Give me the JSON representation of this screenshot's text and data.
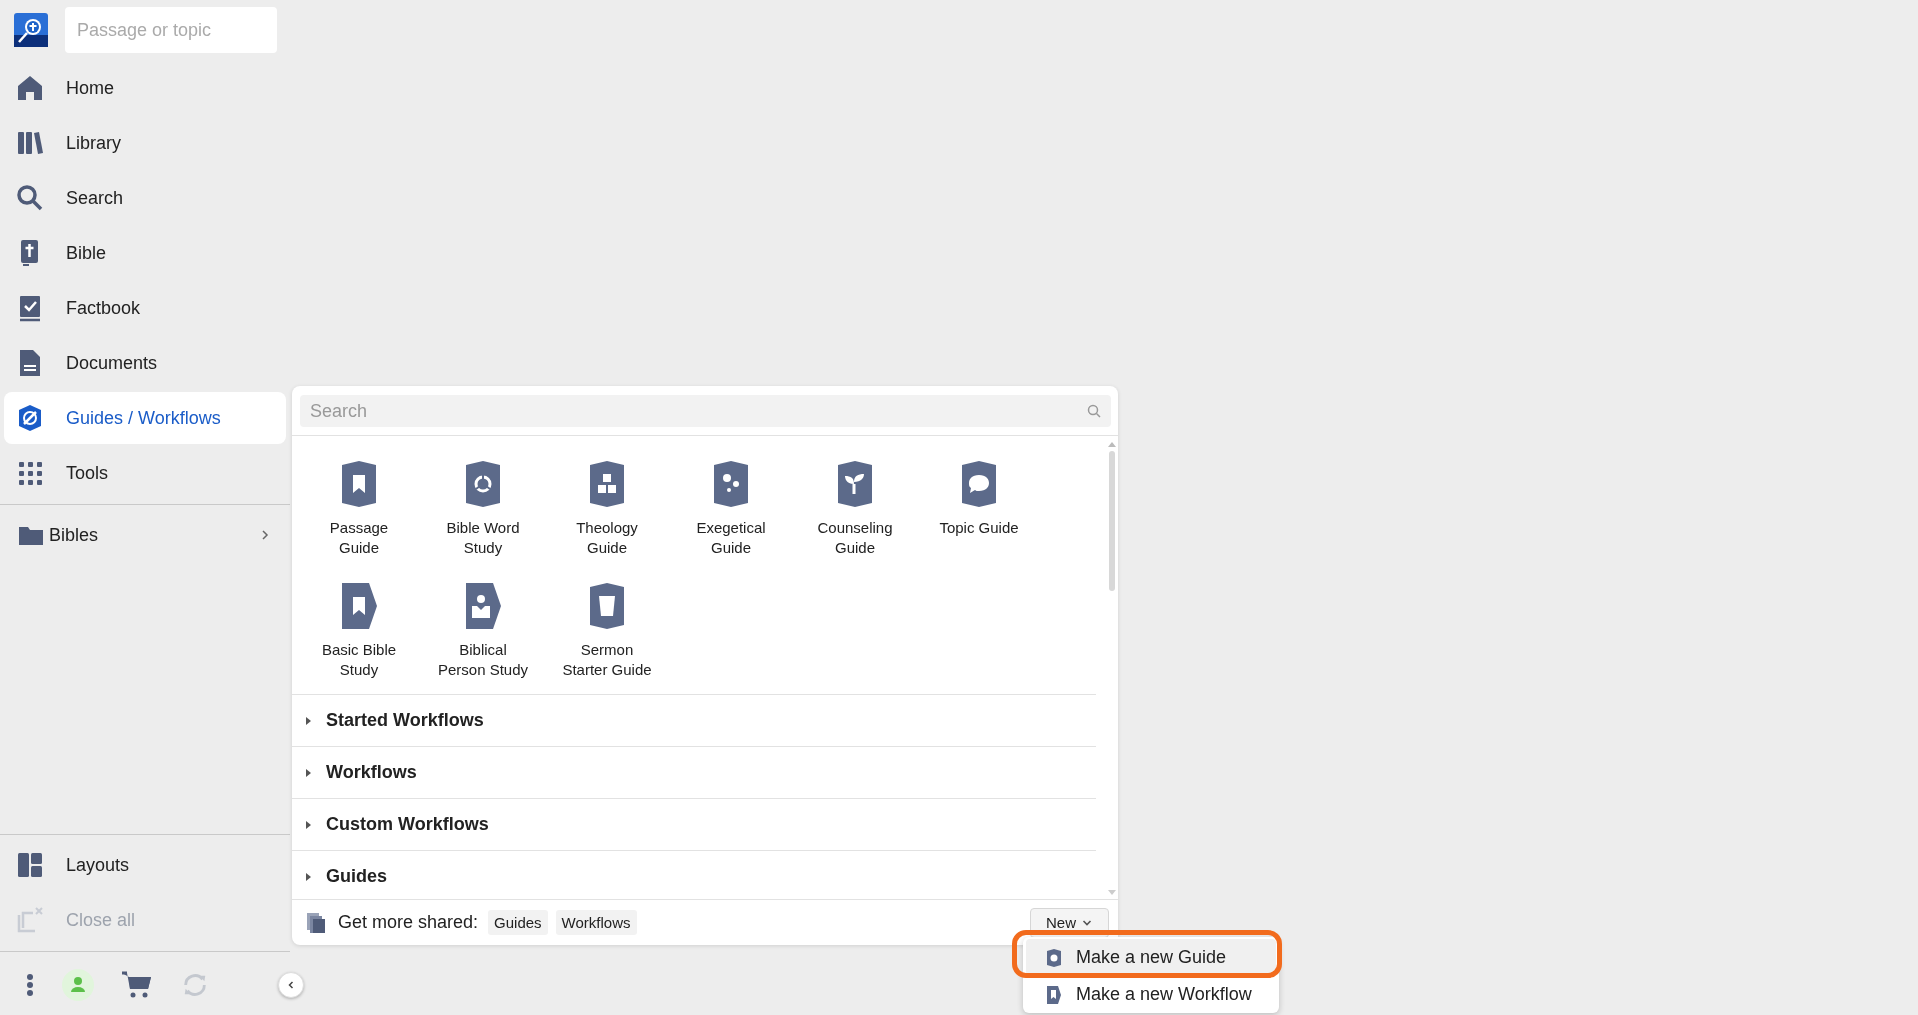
{
  "sidebar": {
    "search": {
      "placeholder": "Passage or topic"
    },
    "nav": [
      {
        "label": "Home",
        "selected": false
      },
      {
        "label": "Library",
        "selected": false
      },
      {
        "label": "Search",
        "selected": false
      },
      {
        "label": "Bible",
        "selected": false
      },
      {
        "label": "Factbook",
        "selected": false
      },
      {
        "label": "Documents",
        "selected": false
      },
      {
        "label": "Guides / Workflows",
        "selected": true
      },
      {
        "label": "Tools",
        "selected": false
      }
    ],
    "folders": [
      {
        "label": "Bibles",
        "expanded": false
      }
    ],
    "bottom_nav": [
      {
        "label": "Layouts",
        "disabled": false
      },
      {
        "label": "Close all",
        "disabled": true
      }
    ]
  },
  "panel": {
    "search": {
      "placeholder": "Search"
    },
    "guides": [
      {
        "label": "Passage Guide"
      },
      {
        "label": "Bible Word Study"
      },
      {
        "label": "Theology Guide"
      },
      {
        "label": "Exegetical Guide"
      },
      {
        "label": "Counseling Guide"
      },
      {
        "label": "Topic Guide"
      },
      {
        "label": "Basic Bible Study"
      },
      {
        "label": "Biblical Person Study"
      },
      {
        "label": "Sermon Starter Guide"
      }
    ],
    "sections": [
      {
        "label": "Started Workflows",
        "expanded": false
      },
      {
        "label": "Workflows",
        "expanded": false
      },
      {
        "label": "Custom Workflows",
        "expanded": false
      },
      {
        "label": "Guides",
        "expanded": false
      }
    ],
    "footer": {
      "label": "Get more shared:",
      "links": [
        "Guides",
        "Workflows"
      ],
      "new_button": "New"
    }
  },
  "new_menu": [
    {
      "label": "Make a new Guide",
      "highlighted": true
    },
    {
      "label": "Make a new Workflow",
      "highlighted": false
    }
  ]
}
